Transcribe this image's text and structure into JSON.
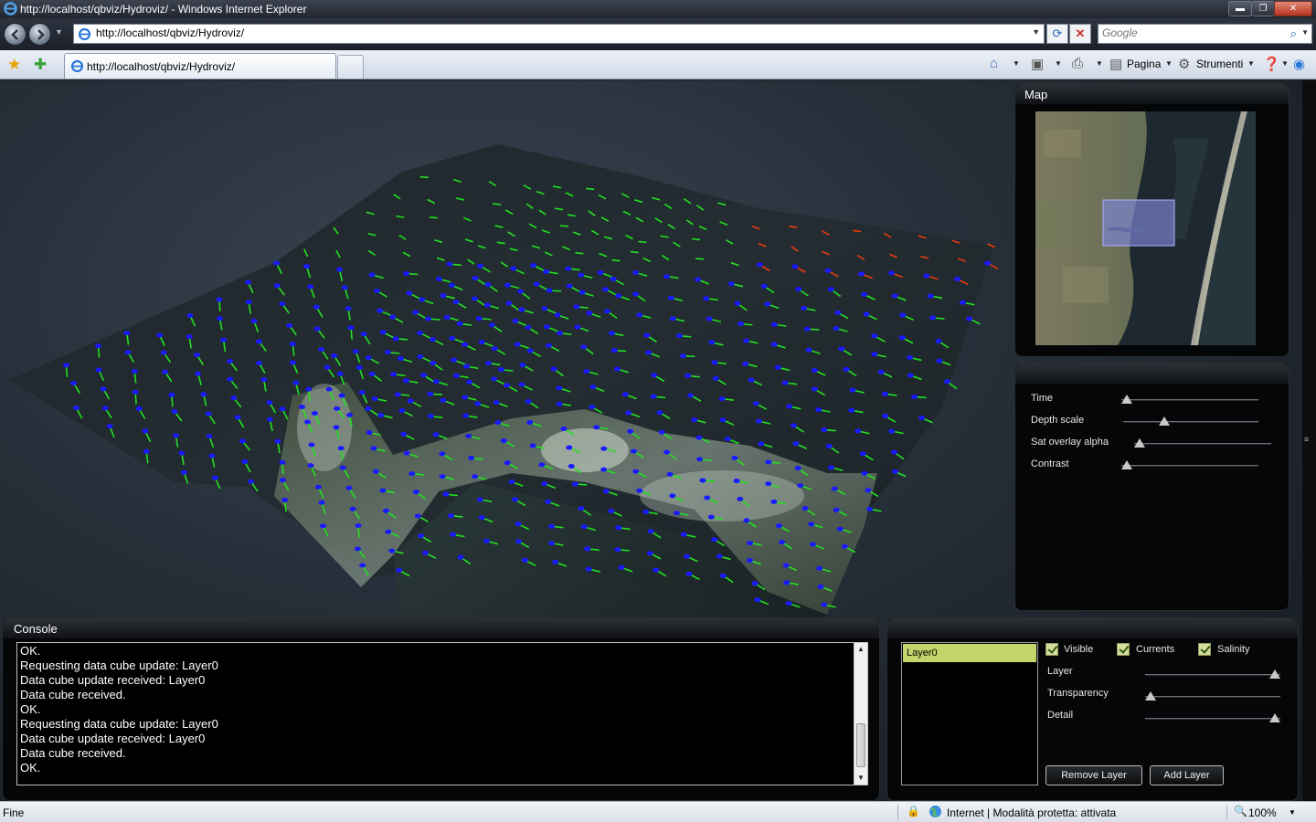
{
  "window": {
    "title": "http://localhost/qbviz/Hydroviz/ - Windows Internet Explorer",
    "minimize_glyph": "▬",
    "maximize_glyph": "❐",
    "close_glyph": "✕"
  },
  "address": {
    "url": "http://localhost/qbviz/Hydroviz/",
    "search_placeholder": "Google"
  },
  "tab": {
    "title": "http://localhost/qbviz/Hydroviz/"
  },
  "commandbar": {
    "page_label": "Pagina",
    "tools_label": "Strumenti"
  },
  "map_panel": {
    "title": "Map"
  },
  "controls": [
    {
      "label": "Time",
      "value": 0.0
    },
    {
      "label": "Depth scale",
      "value": 0.29
    },
    {
      "label": "Sat overlay alpha",
      "value": 0.0
    },
    {
      "label": "Contrast",
      "value": 0.0
    }
  ],
  "console": {
    "title": "Console",
    "lines": [
      "OK.",
      "Requesting data cube update: Layer0",
      "Data cube update received: Layer0",
      "Data cube received.",
      "OK.",
      "Requesting data cube update: Layer0",
      "Data cube update received: Layer0",
      "Data cube received.",
      "OK."
    ]
  },
  "layers": {
    "items": [
      "Layer0"
    ],
    "checkboxes": [
      {
        "label": "Visible",
        "checked": true
      },
      {
        "label": "Currents",
        "checked": true
      },
      {
        "label": "Salinity",
        "checked": true
      }
    ],
    "sliders": [
      {
        "label": "Layer",
        "value": 1.0
      },
      {
        "label": "Transparency",
        "value": 0.0
      },
      {
        "label": "Detail",
        "value": 1.0
      }
    ],
    "remove_label": "Remove Layer",
    "add_label": "Add Layer"
  },
  "statusbar": {
    "status": "Fine",
    "zone": "Internet | Modalità protetta: attivata",
    "zoom": "100%"
  },
  "colors": {
    "arrow_blue": "#1a1aff",
    "arrow_green": "#22e022",
    "arrow_red": "#e83a10",
    "layer_selected": "#c4d46a"
  }
}
